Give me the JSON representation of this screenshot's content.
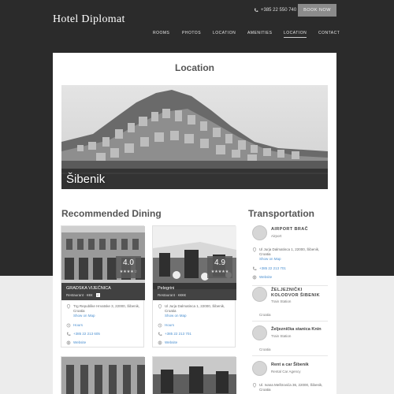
{
  "header": {
    "brand": "Hotel Diplomat",
    "phone": "+385 22 550 740",
    "book_label": "BOOK NOW",
    "nav": [
      "ROOMS",
      "PHOTOS",
      "LOCATION",
      "AMENITIES",
      "LOCATION",
      "CONTACT"
    ]
  },
  "page": {
    "title": "Location",
    "hero_caption": "Šibenik",
    "dining_title": "Recommended Dining",
    "transport_title": "Transportation"
  },
  "dining": [
    {
      "name": "GRADSKA VIJEĆNICA",
      "type": "Restaurant · €€€",
      "rating": "4.0",
      "stars": "★★★★☆",
      "address": "Trg Republike Hrvatske 3, 22000, Šibenik, Croatia",
      "map_link": "Show on Map",
      "hours": "Hours",
      "phone": "+385 22 213 605",
      "website": "Website"
    },
    {
      "name": "Pelegrini",
      "type": "Restaurant · €€€€",
      "rating": "4.9",
      "stars": "★★★★★",
      "address": "Ul Jurja Dalmatinca 1, 22000, Šibenik, Croatia",
      "map_link": "Show on Map",
      "hours": "Hours",
      "phone": "+385 22 213 701",
      "website": "Website"
    }
  ],
  "transport": [
    {
      "name": "AIRPORT BRAČ",
      "type": "Airport",
      "address": "Ul Jurja Dalmatinca 1, 22000, Šibenik, Croatia",
      "map_link": "Show on Map",
      "phone": "+385 22 213 701",
      "website": "Website"
    },
    {
      "name": "ŽELJEZNIČKI KOLODVOR ŠIBENIK",
      "type": "Train Station",
      "country": "Croatia"
    },
    {
      "name": "Željeznička stanica Knin",
      "type": "Train Station",
      "country": "Croatia"
    },
    {
      "name": "Rent a car Šibenik",
      "type": "Rental Car Agency",
      "address": "Ul. Ivana Meštrovića 36, 22000, Šibenik, Croatia"
    }
  ],
  "colors": {
    "header_bg": "#2b2b2b",
    "button_bg": "#8b8b8b",
    "link": "#4a8fd0"
  }
}
